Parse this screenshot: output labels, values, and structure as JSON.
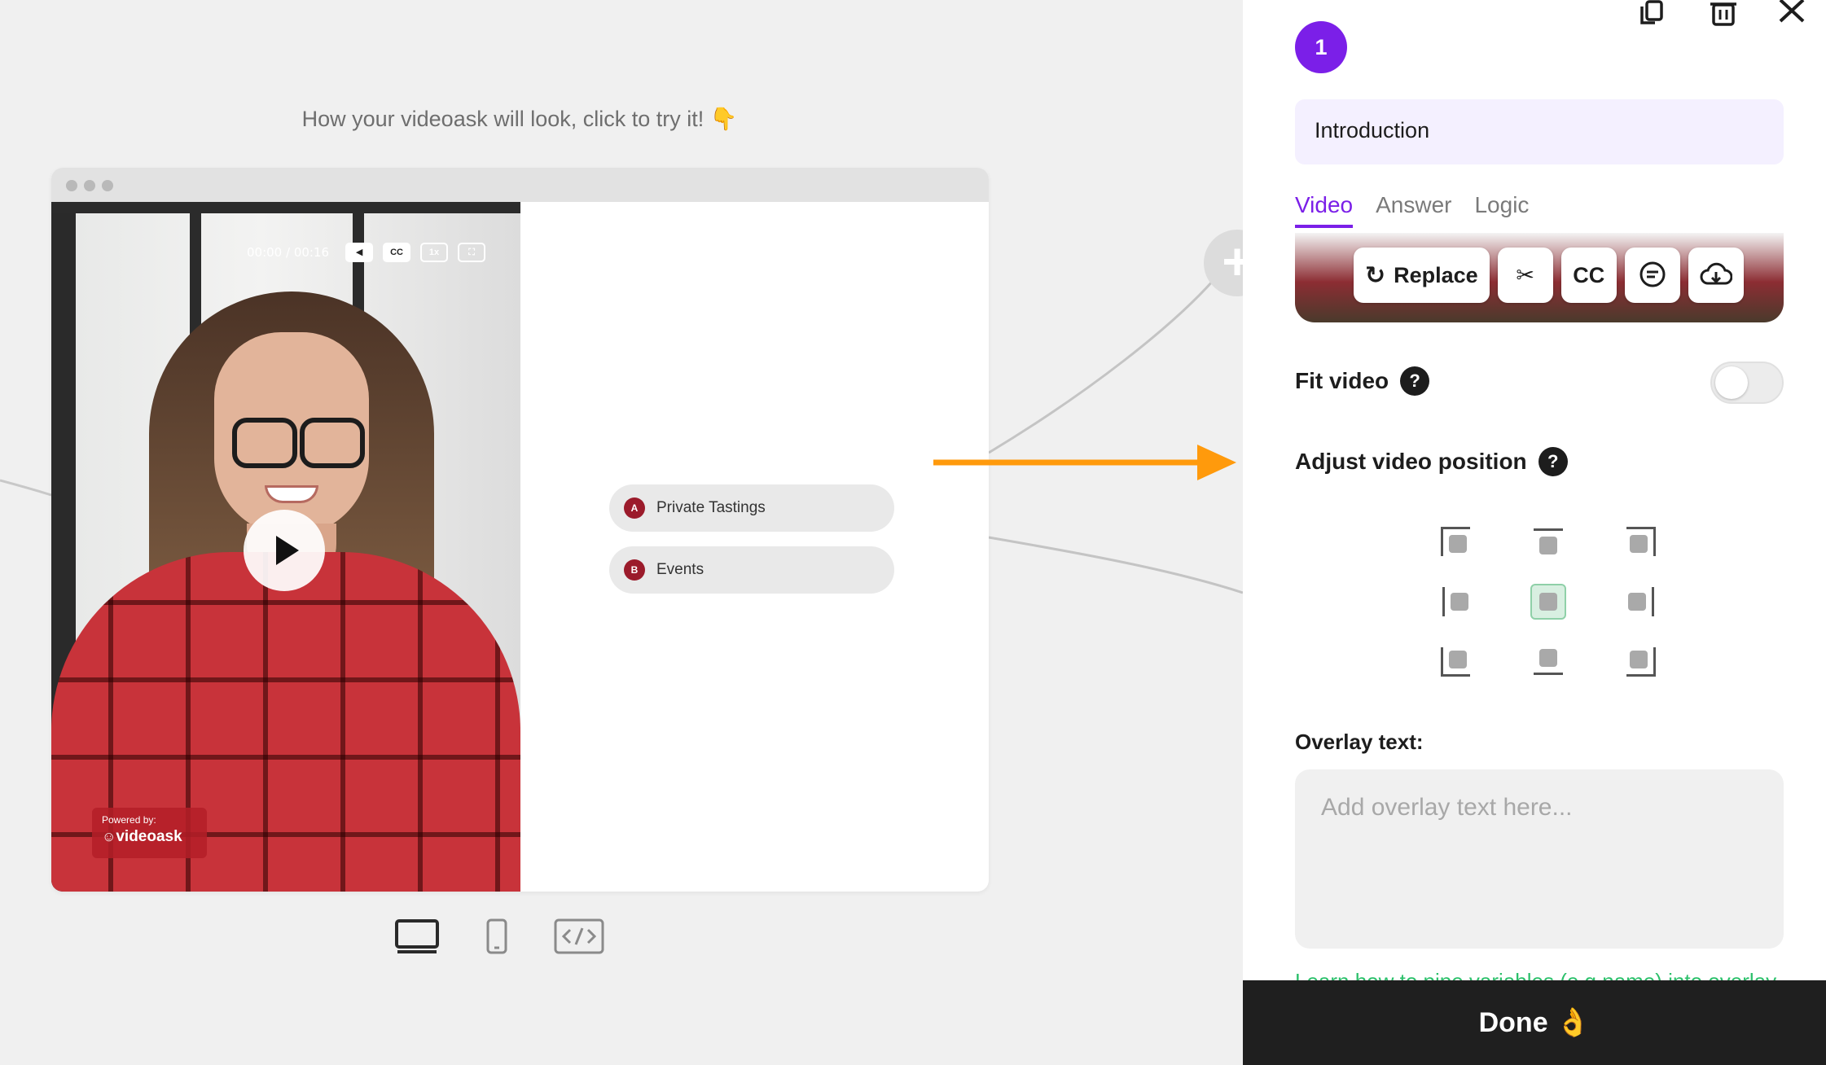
{
  "preview": {
    "caption": "How your videoask will look, click to try it! 👇",
    "add_node_label": "+",
    "video": {
      "time": "00:00 / 00:16",
      "cc_label": "CC",
      "speed_label": "1x",
      "powered_label": "Powered by:",
      "powered_brand": "videoask"
    },
    "answers": [
      {
        "letter": "A",
        "text": "Private Tastings"
      },
      {
        "letter": "B",
        "text": "Events"
      }
    ],
    "devices": [
      "desktop-icon",
      "mobile-icon",
      "embed-code-icon"
    ],
    "arrow_color": "#ff9a0c"
  },
  "panel": {
    "step_number": "1",
    "step_title": "Introduction",
    "tabs": [
      {
        "label": "Video",
        "active": true
      },
      {
        "label": "Answer",
        "active": false
      },
      {
        "label": "Logic",
        "active": false
      }
    ],
    "toolbar": {
      "replace_label": "Replace",
      "cc_label": "CC"
    },
    "fit_video": {
      "label": "Fit video",
      "enabled": false
    },
    "adjust_position": {
      "label": "Adjust video position",
      "selected": "center"
    },
    "overlay": {
      "label": "Overlay text:",
      "placeholder": "Add overlay text here...",
      "value": ""
    },
    "pipe_link": "Learn how to pipe variables (e.g name) into overlay text",
    "done_label": "Done 👌",
    "accent_color": "#7b1fe8",
    "link_color": "#2bbf6a"
  }
}
